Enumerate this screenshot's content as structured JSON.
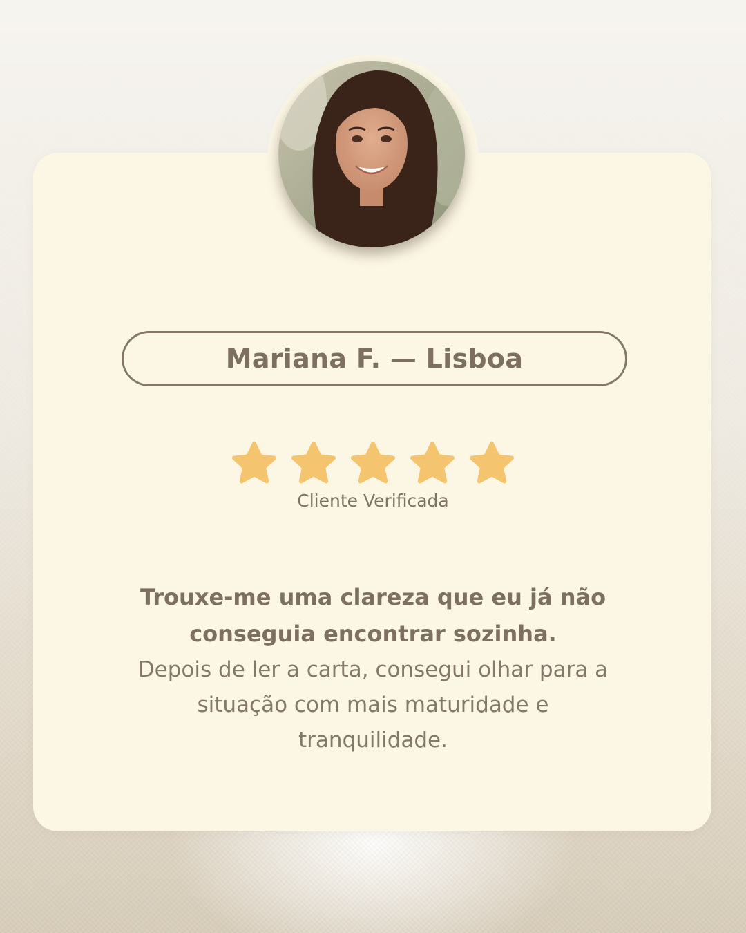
{
  "testimonial": {
    "name_location": "Mariana F. — Lisboa",
    "rating": 5,
    "rating_max": 5,
    "verified_label": "Cliente Verificada",
    "quote_highlight_line1": "Trouxe-me uma clareza que eu já não",
    "quote_highlight_line2": "conseguia encontrar sozinha.",
    "quote_body_line1": "Depois de ler a carta, consegui olhar para a",
    "quote_body_line2": "situação com mais maturidade e",
    "quote_body_line3": "tranquilidade."
  },
  "colors": {
    "card_background": "#fcf6e5",
    "text_primary": "#7d7061",
    "star_fill": "#f5c46e",
    "pill_border": "#857869"
  },
  "icons": {
    "star": "star-icon",
    "avatar": "customer-photo"
  }
}
